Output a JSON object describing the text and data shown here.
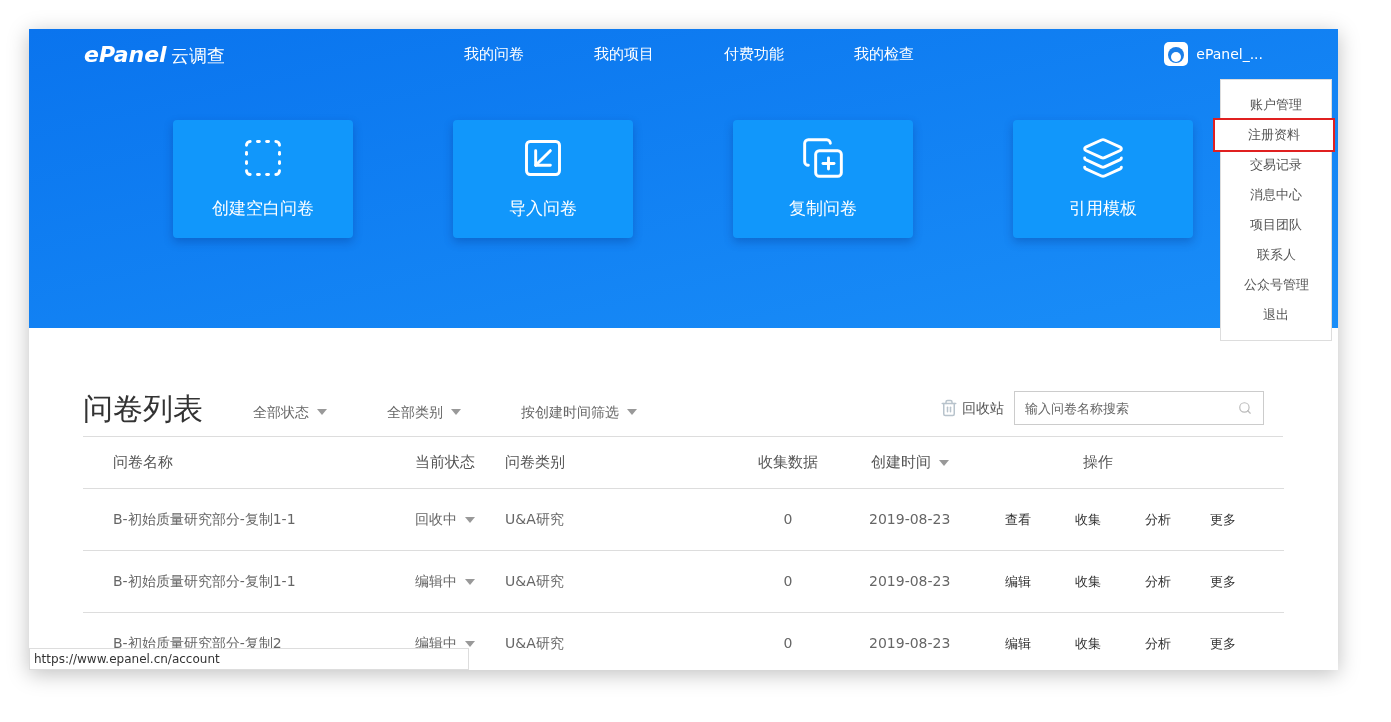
{
  "header": {
    "logo": {
      "brand": "ePanel",
      "suffix": "云调查"
    },
    "nav": [
      "我的问卷",
      "我的项目",
      "付费功能",
      "我的检查"
    ],
    "user": {
      "name": "ePanel_..."
    }
  },
  "user_menu": [
    {
      "label": "账户管理",
      "selected": false
    },
    {
      "label": "注册资料",
      "selected": true
    },
    {
      "label": "交易记录",
      "selected": false
    },
    {
      "label": "消息中心",
      "selected": false
    },
    {
      "label": "项目团队",
      "selected": false
    },
    {
      "label": "联系人",
      "selected": false
    },
    {
      "label": "公众号管理",
      "selected": false
    },
    {
      "label": "退出",
      "selected": false
    }
  ],
  "actions": [
    {
      "kind": "blank",
      "label": "创建空白问卷"
    },
    {
      "kind": "import",
      "label": "导入问卷"
    },
    {
      "kind": "copy",
      "label": "复制问卷"
    },
    {
      "kind": "template",
      "label": "引用模板"
    }
  ],
  "list": {
    "title": "问卷列表",
    "filters": [
      "全部状态",
      "全部类别",
      "按创建时间筛选"
    ],
    "recycle": "回收站",
    "search": {
      "placeholder": "输入问卷名称搜索"
    },
    "columns": [
      "问卷名称",
      "当前状态",
      "问卷类别",
      "收集数据",
      "创建时间",
      "操作"
    ],
    "rows": [
      {
        "name": "B-初始质量研究部分-复制1-1",
        "status": "回收中",
        "category": "U&A研究",
        "count": "0",
        "date": "2019-08-23",
        "ops": [
          "查看",
          "收集",
          "分析",
          "更多"
        ]
      },
      {
        "name": "B-初始质量研究部分-复制1-1",
        "status": "编辑中",
        "category": "U&A研究",
        "count": "0",
        "date": "2019-08-23",
        "ops": [
          "编辑",
          "收集",
          "分析",
          "更多"
        ]
      },
      {
        "name": "B-初始质量研究部分-复制2",
        "status": "编辑中",
        "category": "U&A研究",
        "count": "0",
        "date": "2019-08-23",
        "ops": [
          "编辑",
          "收集",
          "分析",
          "更多"
        ]
      }
    ]
  },
  "status_bar": {
    "url": "https://www.epanel.cn/account"
  }
}
